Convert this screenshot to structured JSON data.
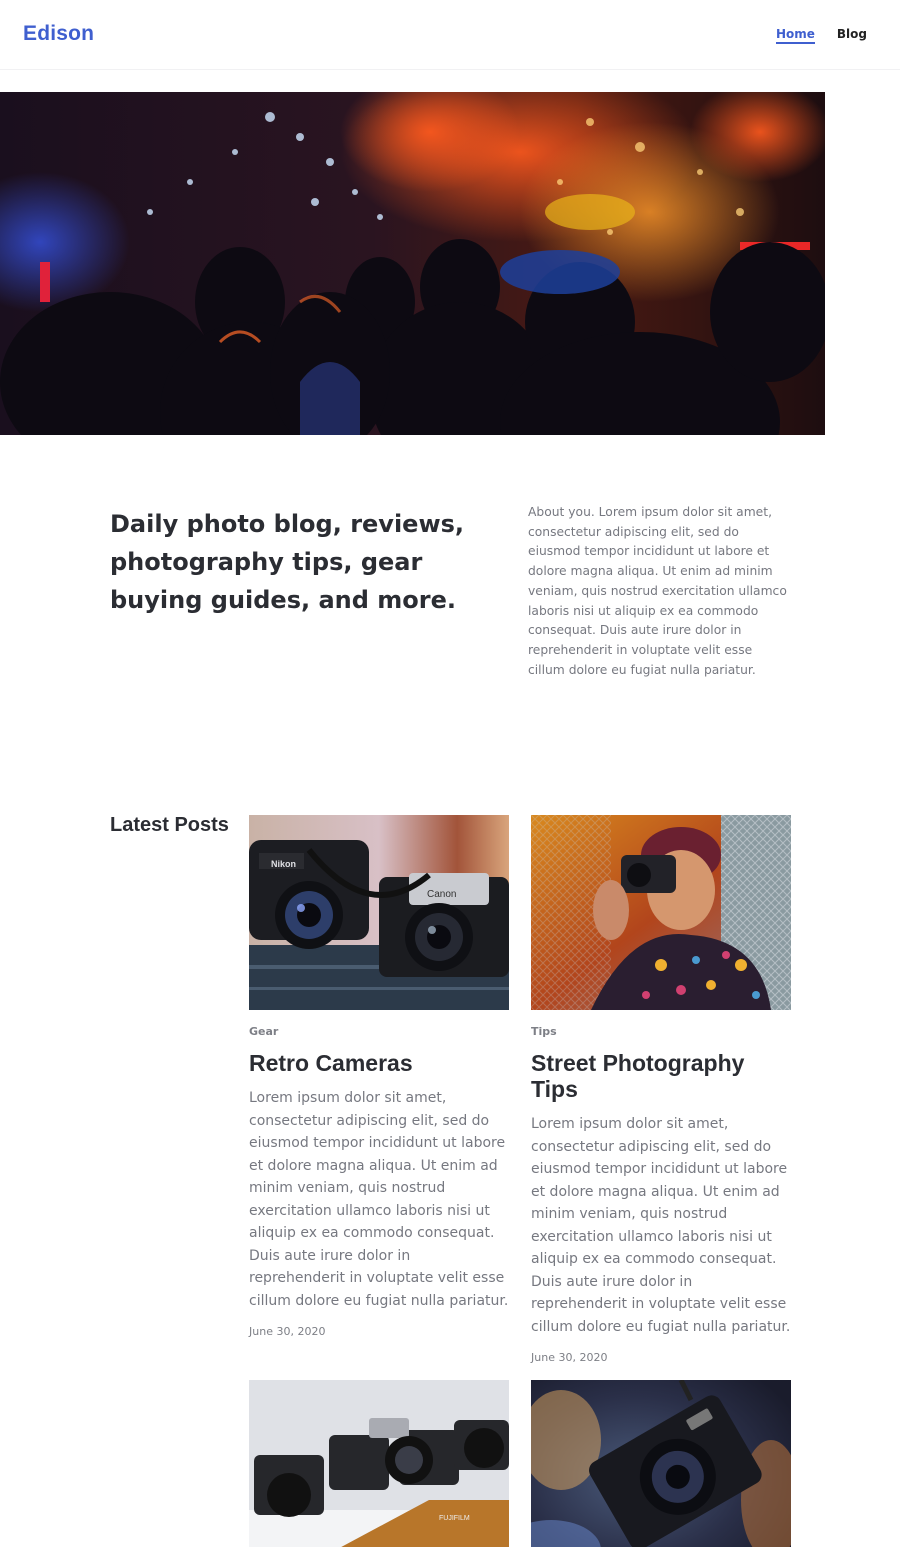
{
  "site": {
    "logo": "Edison"
  },
  "nav": {
    "items": [
      {
        "label": "Home",
        "active": true
      },
      {
        "label": "Blog",
        "active": false
      }
    ]
  },
  "intro": {
    "heading": "Daily photo blog, reviews, photography tips, gear buying guides, and more.",
    "about": "About you. Lorem ipsum dolor sit amet, consectetur adipiscing elit, sed do eiusmod tempor incididunt ut labore et dolore magna aliqua. Ut enim ad minim veniam, quis nostrud exercitation ullamco laboris nisi ut aliquip ex ea commodo consequat. Duis aute irure dolor in reprehenderit in voluptate velit esse cillum dolore eu fugiat nulla pariatur."
  },
  "latest": {
    "title": "Latest Posts",
    "posts": [
      {
        "category": "Gear",
        "title": "Retro Cameras",
        "excerpt": "Lorem ipsum dolor sit amet, consectetur adipiscing elit, sed do eiusmod tempor incididunt ut labore et dolore magna aliqua. Ut enim ad minim veniam, quis nostrud exercitation ullamco laboris nisi ut aliquip ex ea commodo consequat. Duis aute irure dolor in reprehenderit in voluptate velit esse cillum dolore eu fugiat nulla pariatur.",
        "date": "June 30, 2020"
      },
      {
        "category": "Tips",
        "title": "Street Photography Tips",
        "excerpt": "Lorem ipsum dolor sit amet, consectetur adipiscing elit, sed do eiusmod tempor incididunt ut labore et dolore magna aliqua. Ut enim ad minim veniam, quis nostrud exercitation ullamco laboris nisi ut aliquip ex ea commodo consequat. Duis aute irure dolor in reprehenderit in voluptate velit esse cillum dolore eu fugiat nulla pariatur.",
        "date": "June 30, 2020"
      }
    ]
  },
  "photo_labels": {
    "nikon": "Nikon",
    "canon": "Canon",
    "fujifilm": "FUJIFILM"
  },
  "colors": {
    "accent": "#3f5fcf",
    "text": "#2b2d33",
    "muted": "#767880"
  }
}
